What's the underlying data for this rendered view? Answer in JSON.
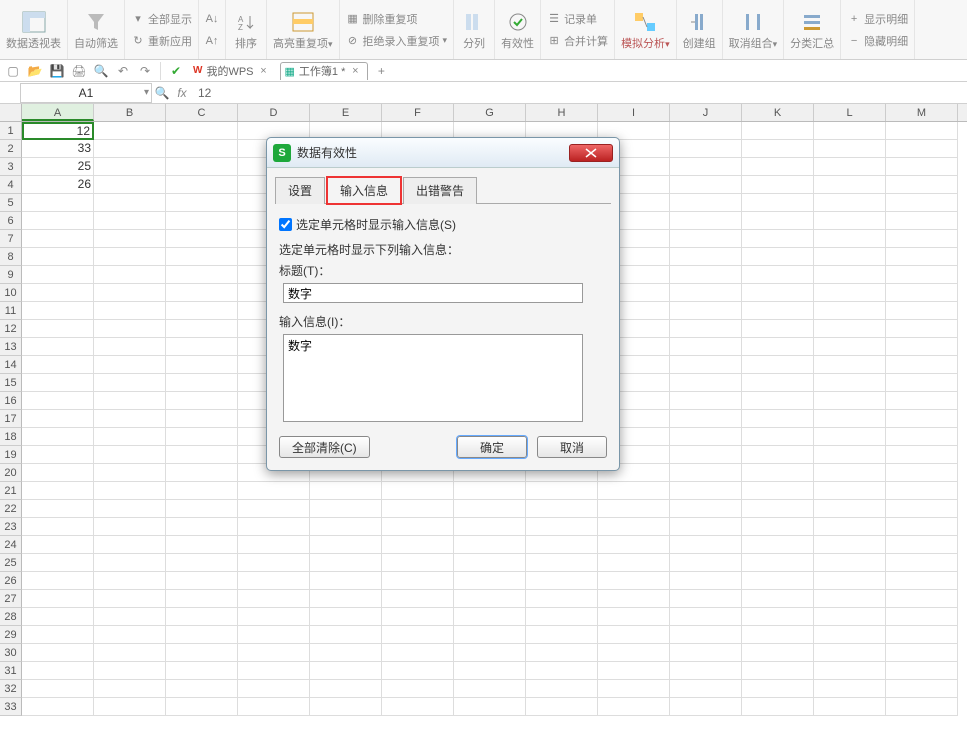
{
  "ribbon": {
    "pivot": "数据透视表",
    "autofilter": "自动筛选",
    "show_all": "全部显示",
    "reapply": "重新应用",
    "sort": "排序",
    "highlight_dup": "高亮重复项",
    "remove_dup": "删除重复项",
    "reject_dup": "拒绝录入重复项",
    "text_to_cols": "分列",
    "validity": "有效性",
    "record_form": "记录单",
    "consolidate": "合并计算",
    "what_if": "模拟分析",
    "group_create": "创建组",
    "ungroup": "取消组合",
    "subtotal": "分类汇总",
    "show_detail": "显示明细",
    "hide_detail": "隐藏明细"
  },
  "tabs": {
    "wps": "我的WPS",
    "workbook": "工作簿1 *"
  },
  "formula_bar": {
    "cell_ref": "A1",
    "fx": "fx",
    "value": "12"
  },
  "columns": [
    "A",
    "B",
    "C",
    "D",
    "E",
    "F",
    "G",
    "H",
    "I",
    "J",
    "K",
    "L",
    "M"
  ],
  "row_count": 33,
  "data_cells": {
    "A1": "12",
    "A2": "33",
    "A3": "25",
    "A4": "26"
  },
  "selected_cell": "A1",
  "dialog": {
    "title": "数据有效性",
    "tabs": {
      "settings": "设置",
      "input_msg": "输入信息",
      "error_alert": "出错警告"
    },
    "active_tab": "输入信息",
    "checkbox_label": "选定单元格时显示输入信息(S)",
    "checkbox_checked": true,
    "group_label": "选定单元格时显示下列输入信息：",
    "title_label": "标题(T)：",
    "title_value": "数字",
    "msg_label": "输入信息(I)：",
    "msg_value": "数字",
    "clear_all": "全部清除(C)",
    "ok": "确定",
    "cancel": "取消"
  }
}
